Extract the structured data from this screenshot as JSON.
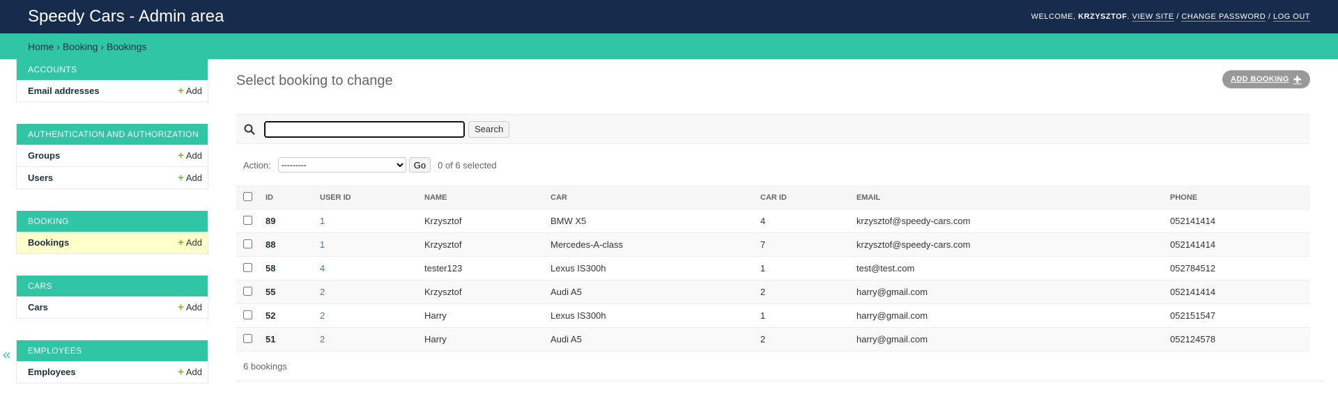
{
  "header": {
    "site_title": "Speedy Cars - Admin area",
    "welcome": "Welcome,",
    "username": "Krzysztof",
    "view_site": "View site",
    "change_password": "Change password",
    "log_out": "Log out"
  },
  "breadcrumbs": {
    "home": "Home",
    "app": "Booking",
    "model": "Bookings",
    "separator": "›"
  },
  "sidebar": {
    "toggle": "«",
    "add_label": "Add",
    "modules": [
      {
        "caption": "Accounts",
        "models": [
          {
            "name": "Email addresses"
          }
        ]
      },
      {
        "caption": "Authentication and Authorization",
        "models": [
          {
            "name": "Groups"
          },
          {
            "name": "Users"
          }
        ]
      },
      {
        "caption": "Booking",
        "models": [
          {
            "name": "Bookings"
          }
        ]
      },
      {
        "caption": "Cars",
        "models": [
          {
            "name": "Cars"
          }
        ]
      },
      {
        "caption": "Employees",
        "models": [
          {
            "name": "Employees"
          }
        ]
      }
    ]
  },
  "main": {
    "title": "Select booking to change",
    "add_button": "Add booking",
    "search": {
      "value": "",
      "button": "Search"
    },
    "actions": {
      "label": "Action:",
      "selected_option": "---------",
      "go": "Go",
      "counter": "0 of 6 selected"
    },
    "table": {
      "columns": [
        "ID",
        "User ID",
        "Name",
        "Car",
        "Car ID",
        "Email",
        "Phone"
      ],
      "rows": [
        {
          "id": "89",
          "user_id": "1",
          "name": "Krzysztof",
          "car": "BMW X5",
          "car_id": "4",
          "email": "krzysztof@speedy-cars.com",
          "phone": "052141414"
        },
        {
          "id": "88",
          "user_id": "1",
          "name": "Krzysztof",
          "car": "Mercedes-A-class",
          "car_id": "7",
          "email": "krzysztof@speedy-cars.com",
          "phone": "052141414"
        },
        {
          "id": "58",
          "user_id": "4",
          "name": "tester123",
          "car": "Lexus IS300h",
          "car_id": "1",
          "email": "test@test.com",
          "phone": "052784512"
        },
        {
          "id": "55",
          "user_id": "2",
          "name": "Krzysztof",
          "car": "Audi A5",
          "car_id": "2",
          "email": "harry@gmail.com",
          "phone": "052141414"
        },
        {
          "id": "52",
          "user_id": "2",
          "name": "Harry",
          "car": "Lexus IS300h",
          "car_id": "1",
          "email": "harry@gmail.com",
          "phone": "052151547"
        },
        {
          "id": "51",
          "user_id": "2",
          "name": "Harry",
          "car": "Audi A5",
          "car_id": "2",
          "email": "harry@gmail.com",
          "phone": "052124578"
        }
      ]
    },
    "paginator": "6 bookings"
  },
  "colors": {
    "header_bg": "#172b4d",
    "accent": "#2fc5a5",
    "add_icon": "#70bf2b",
    "current_row": "#ffffcc"
  }
}
